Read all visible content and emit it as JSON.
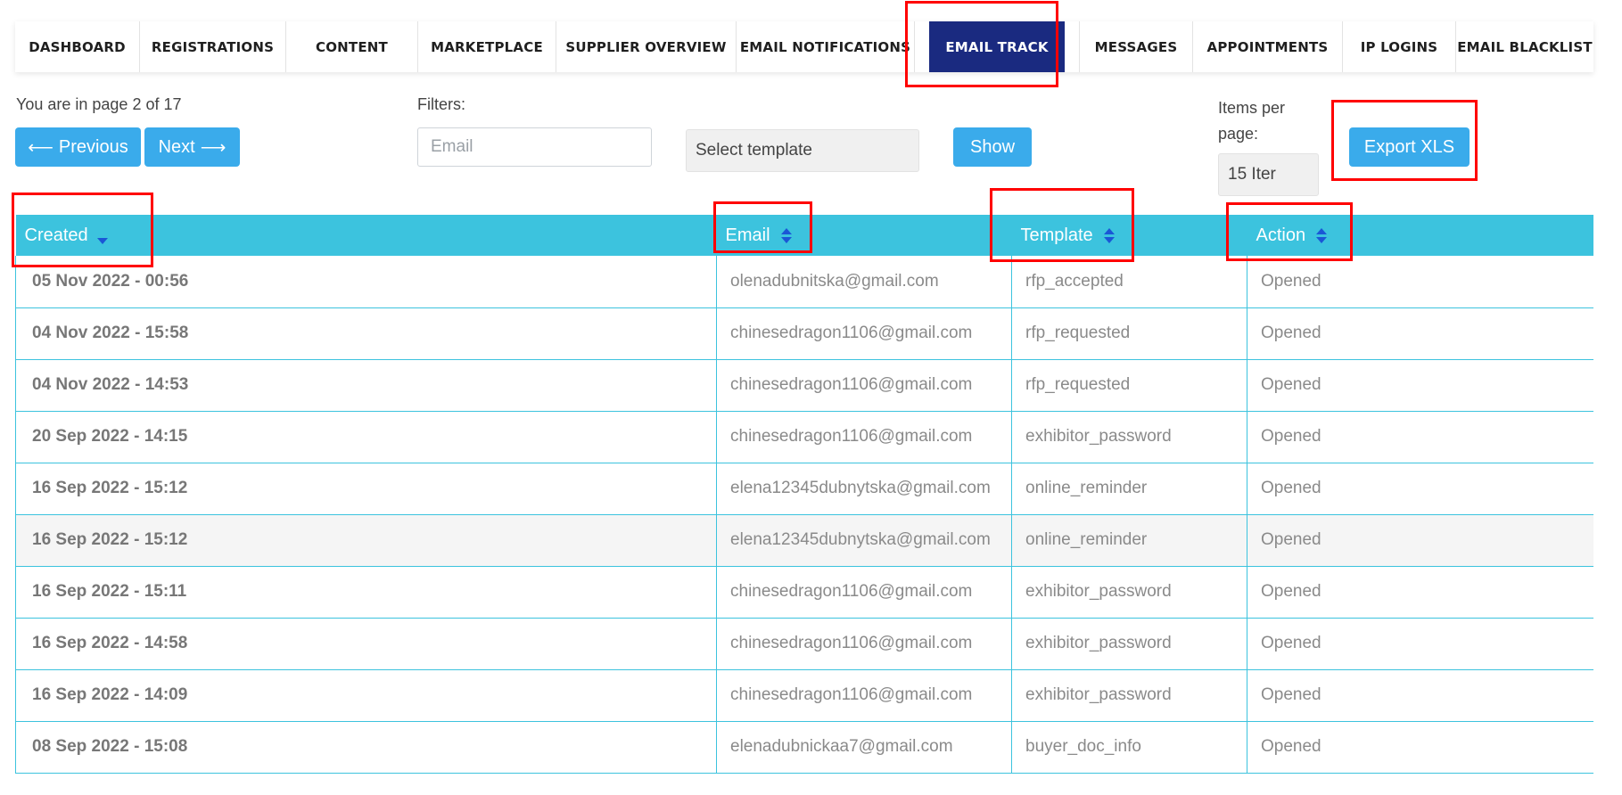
{
  "nav": {
    "items": [
      {
        "label": "DASHBOARD"
      },
      {
        "label": "REGISTRATIONS"
      },
      {
        "label": "CONTENT"
      },
      {
        "label": "MARKETPLACE"
      },
      {
        "label": "SUPPLIER OVERVIEW"
      },
      {
        "label": "EMAIL NOTIFICATIONS"
      },
      {
        "label": "EMAIL TRACK",
        "active": true
      },
      {
        "label": "MESSAGES"
      },
      {
        "label": "APPOINTMENTS"
      },
      {
        "label": "IP LOGINS"
      },
      {
        "label": "EMAIL BLACKLIST"
      }
    ]
  },
  "pager": {
    "info": "You are in page 2 of 17",
    "prev_label": "Previous",
    "next_label": "Next"
  },
  "filters": {
    "label": "Filters:",
    "email_placeholder": "Email",
    "template_select": "Select template",
    "show_label": "Show"
  },
  "items_per_page": {
    "label": "Items per page:",
    "value": "15 Iter"
  },
  "export_label": "Export XLS",
  "table": {
    "columns": [
      "Created",
      "Email",
      "Template",
      "Action"
    ],
    "rows": [
      {
        "created": "05 Nov 2022 - 00:56",
        "email": "olenadubnitska@gmail.com",
        "template": "rfp_accepted",
        "action": "Opened"
      },
      {
        "created": "04 Nov 2022 - 15:58",
        "email": "chinesedragon1106@gmail.com",
        "template": "rfp_requested",
        "action": "Opened"
      },
      {
        "created": "04 Nov 2022 - 14:53",
        "email": "chinesedragon1106@gmail.com",
        "template": "rfp_requested",
        "action": "Opened"
      },
      {
        "created": "20 Sep 2022 - 14:15",
        "email": "chinesedragon1106@gmail.com",
        "template": "exhibitor_password",
        "action": "Opened"
      },
      {
        "created": "16 Sep 2022 - 15:12",
        "email": "elena12345dubnytska@gmail.com",
        "template": "online_reminder",
        "action": "Opened"
      },
      {
        "created": "16 Sep 2022 - 15:12",
        "email": "elena12345dubnytska@gmail.com",
        "template": "online_reminder",
        "action": "Opened"
      },
      {
        "created": "16 Sep 2022 - 15:11",
        "email": "chinesedragon1106@gmail.com",
        "template": "exhibitor_password",
        "action": "Opened"
      },
      {
        "created": "16 Sep 2022 - 14:58",
        "email": "chinesedragon1106@gmail.com",
        "template": "exhibitor_password",
        "action": "Opened"
      },
      {
        "created": "16 Sep 2022 - 14:09",
        "email": "chinesedragon1106@gmail.com",
        "template": "exhibitor_password",
        "action": "Opened"
      },
      {
        "created": "08 Sep 2022 - 15:08",
        "email": "elenadubnickaa7@gmail.com",
        "template": "buyer_doc_info",
        "action": "Opened"
      }
    ]
  },
  "colors": {
    "accent": "#3cc3de",
    "button": "#3aabeb",
    "active_nav": "#1a2a80",
    "highlight": "#ff0000"
  }
}
